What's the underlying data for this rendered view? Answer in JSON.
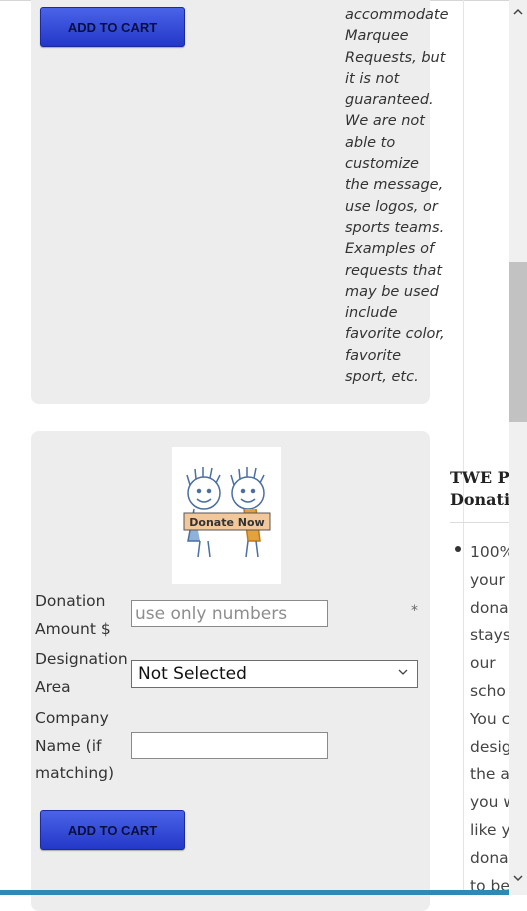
{
  "product": {
    "add_to_cart_label": "ADD TO CART",
    "description_lines": [
      "accommodate",
      "Marquee",
      "Requests, but",
      "it is not",
      "guaranteed.",
      "We are not",
      "able to",
      "customize",
      "the message,",
      "use logos, or",
      "sports teams.",
      "Examples of",
      "requests that",
      "may be used",
      "include",
      "favorite color,",
      "favorite",
      "sport, etc."
    ]
  },
  "donation": {
    "image_text": "Donate Now",
    "amount_label_line1": "Donation",
    "amount_label_line2": "Amount $",
    "amount_placeholder": "use only numbers",
    "required_marker": "*",
    "designation_label_line1": "Designation",
    "designation_label_line2": "Area",
    "designation_selected": "Not Selected",
    "company_label_line1": "Company",
    "company_label_line2": "Name (if",
    "company_label_line3": "matching)",
    "company_value": "",
    "add_to_cart_label": "ADD TO CART"
  },
  "sidebar": {
    "title_line1": "TWE PTA",
    "title_line2": "Donation",
    "bullet_lines": [
      "100%",
      "your",
      "dona",
      "stays",
      "our",
      "scho",
      "You c",
      "desig",
      "the a",
      "you w",
      "like y",
      "dona",
      "to be"
    ]
  },
  "colors": {
    "button_blue": "#3248d6",
    "card_bg": "#ededed",
    "scroll_accent": "#2c8ab3"
  }
}
